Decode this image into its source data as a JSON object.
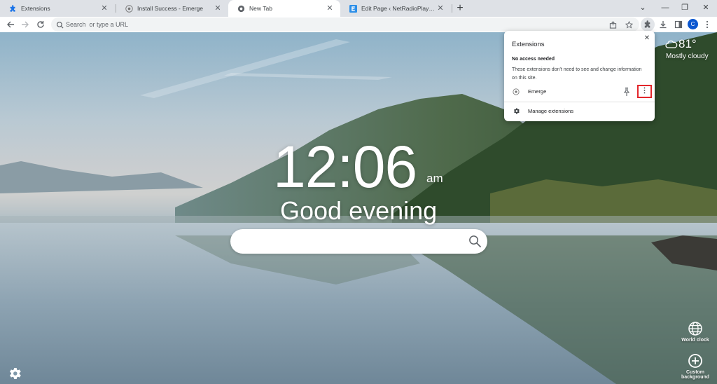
{
  "tabs": [
    {
      "title": "Extensions",
      "favicon": "puzzle-icon",
      "active": false
    },
    {
      "title": "Install Success - Emerge",
      "favicon": "emerge-icon",
      "active": false
    },
    {
      "title": "New Tab",
      "favicon": "newtab-icon",
      "active": true
    },
    {
      "title": "Edit Page ‹ NetRadioPlayer — W",
      "favicon": "letter-e-icon",
      "active": false
    }
  ],
  "tab_close_glyph": "✕",
  "new_tab_glyph": "+",
  "window_controls": {
    "dropdown": "⌄",
    "minimize": "—",
    "restore": "❐",
    "close": "✕"
  },
  "omnibox": {
    "placeholder": "Search  or type a URL",
    "value": ""
  },
  "profile_initial": "C",
  "ntp": {
    "time": "12:06",
    "ampm": "am",
    "greeting": "Good evening",
    "weather": {
      "temp": "81°",
      "condition": "Mostly cloudy"
    },
    "world_clock_label": "World clock",
    "custom_background_label": "Custom background"
  },
  "extensions_popup": {
    "title": "Extensions",
    "section_heading": "No access needed",
    "section_description": "These extensions don't need to see and change information on this site.",
    "extensions": [
      {
        "name": "Emerge"
      }
    ],
    "manage_label": "Manage extensions",
    "kebab_glyph": "⋮",
    "close_glyph": "✕"
  },
  "colors": {
    "accent": "#0b57d0",
    "highlight": "#e3262b",
    "tabstrip": "#dee1e6"
  }
}
